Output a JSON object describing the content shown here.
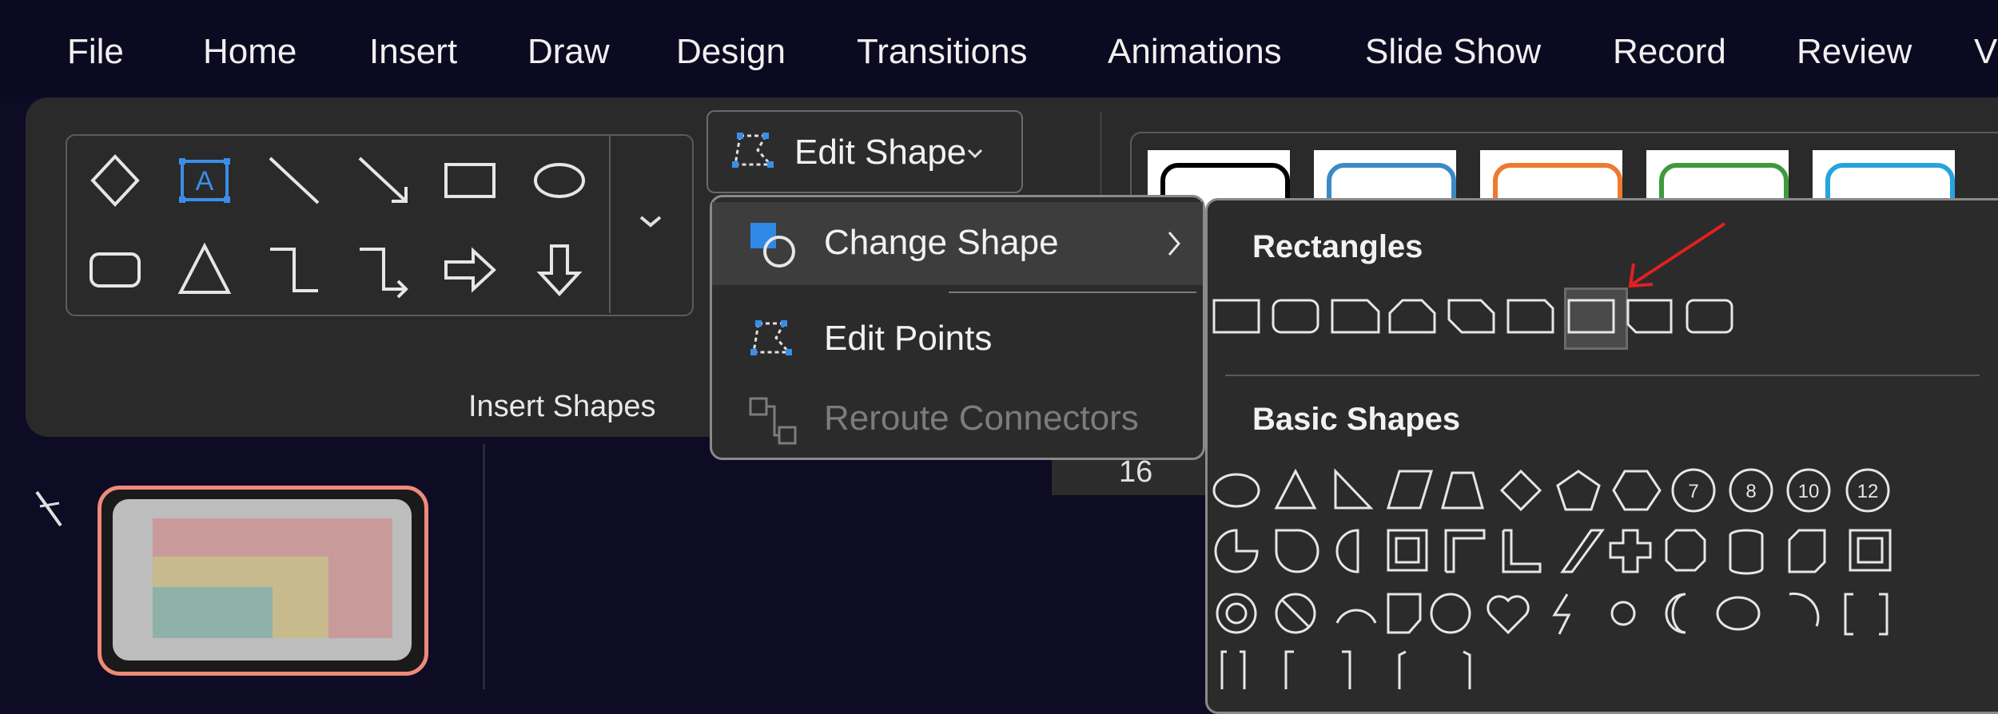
{
  "menu": {
    "items": [
      "File",
      "Home",
      "Insert",
      "Draw",
      "Design",
      "Transitions",
      "Animations",
      "Slide Show",
      "Record",
      "Review",
      "V"
    ]
  },
  "ribbon": {
    "group_label": "Insert Shapes",
    "edit_shape_label": "Edit Shape",
    "shape_gallery_icons": [
      "diamond-icon",
      "text-box-icon",
      "line-icon",
      "arrow-line-icon",
      "rectangle-icon",
      "oval-icon",
      "rounded-rectangle-icon",
      "triangle-icon",
      "elbow-connector-icon",
      "elbow-arrow-connector-icon",
      "right-arrow-icon",
      "down-arrow-icon"
    ],
    "style_colors": [
      "#000000",
      "#3a8bc4",
      "#ee7a30",
      "#3d9a3d",
      "#27a3de"
    ]
  },
  "edit_shape_menu": {
    "items": [
      {
        "label": "Change Shape",
        "icon": "change-shape-icon",
        "has_submenu": true,
        "enabled": true
      },
      {
        "label": "Edit Points",
        "icon": "edit-points-icon",
        "has_submenu": false,
        "enabled": true
      },
      {
        "label": "Reroute Connectors",
        "icon": "reroute-connectors-icon",
        "has_submenu": false,
        "enabled": false
      }
    ]
  },
  "shapes_flyout": {
    "sections": [
      {
        "title": "Rectangles"
      },
      {
        "title": "Basic Shapes"
      }
    ],
    "number_badges": [
      "7",
      "8",
      "10",
      "12"
    ]
  },
  "ruler": {
    "label": "16"
  },
  "colors": {
    "accent": "#2e88e4",
    "selection": "#f08a78",
    "annotation_arrow": "#e12020"
  }
}
